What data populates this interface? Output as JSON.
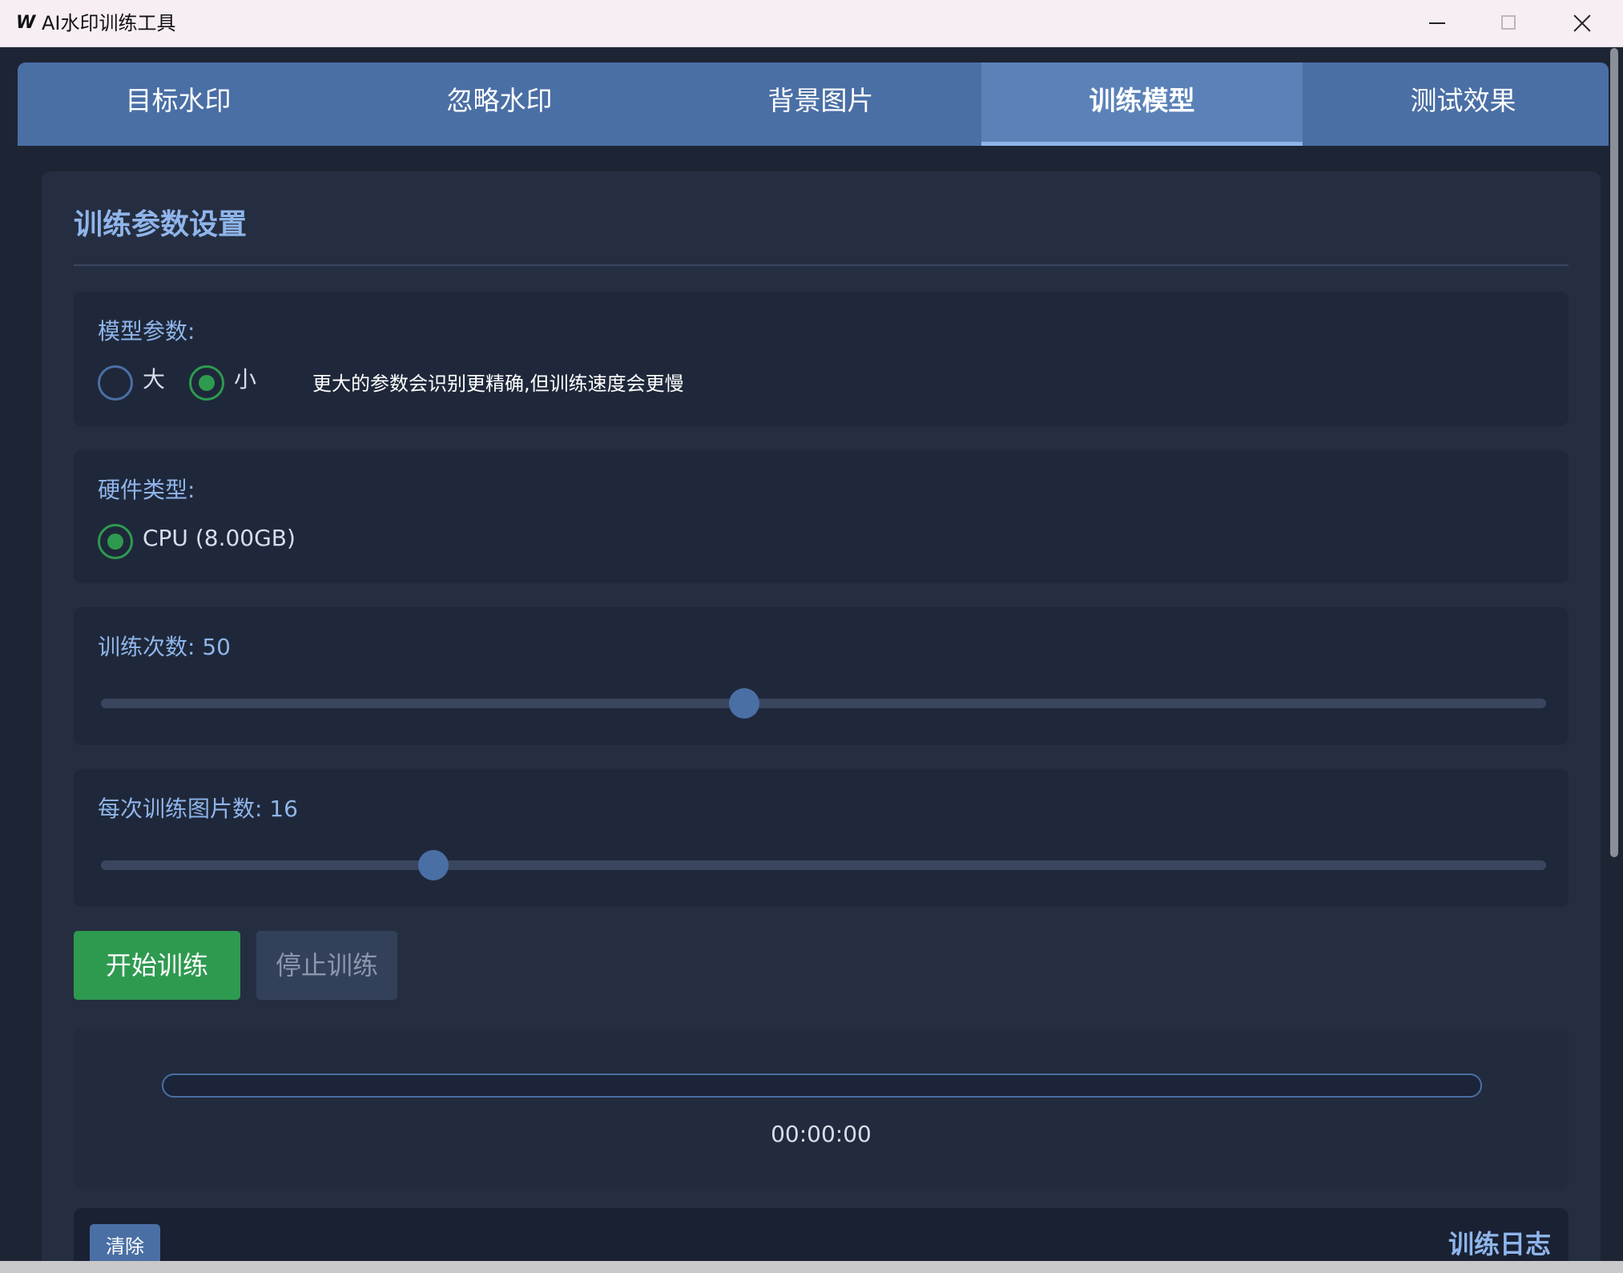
{
  "window": {
    "icon": "W",
    "title": "AI水印训练工具"
  },
  "tabs": [
    {
      "label": "目标水印",
      "active": false
    },
    {
      "label": "忽略水印",
      "active": false
    },
    {
      "label": "背景图片",
      "active": false
    },
    {
      "label": "训练模型",
      "active": true
    },
    {
      "label": "测试效果",
      "active": false
    }
  ],
  "settings": {
    "title": "训练参数设置",
    "model": {
      "label": "模型参数:",
      "options": [
        {
          "label": "大",
          "checked": false
        },
        {
          "label": "小",
          "checked": true
        }
      ],
      "hint": "更大的参数会识别更精确,但训练速度会更慢"
    },
    "hardware": {
      "label": "硬件类型:",
      "option": {
        "label": "CPU (8.00GB)",
        "checked": true
      }
    },
    "epochs": {
      "label": "训练次数: 50",
      "value": 50,
      "fraction": 0.445
    },
    "batch": {
      "label": "每次训练图片数: 16",
      "value": 16,
      "fraction": 0.23
    }
  },
  "actions": {
    "start_label": "开始训练",
    "stop_label": "停止训练"
  },
  "progress": {
    "fraction": 0,
    "timer": "00:00:00"
  },
  "log": {
    "clear_label": "清除",
    "title": "训练日志"
  },
  "colors": {
    "accent": "#4a6fa5",
    "active_tab": "#5b82b8",
    "success": "#2e9a50",
    "label_text": "#8fb5ea"
  },
  "icons": {
    "minimize": "minimize-icon",
    "maximize": "maximize-icon",
    "close": "close-icon"
  }
}
